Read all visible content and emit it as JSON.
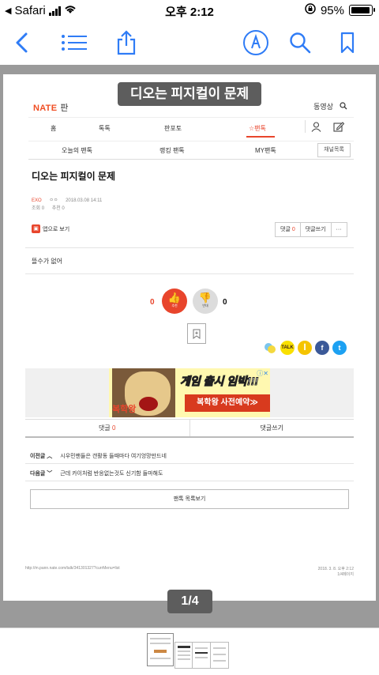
{
  "status_bar": {
    "carrier": "Safari",
    "time": "오후 2:12",
    "battery": "95%"
  },
  "toolbar": {
    "back_icon": "chevron-left-icon",
    "list_icon": "list-icon",
    "share_icon": "share-icon",
    "markup_icon": "markup-pen-icon",
    "search_icon": "search-icon",
    "bookmark_icon": "bookmark-icon"
  },
  "title_overlay": "디오는 피지컬이 문제",
  "page": {
    "logo": "NATE",
    "logo_sub": "판",
    "top_right_video": "동영상",
    "nav1": [
      "홈",
      "톡톡",
      "판포토",
      "☆팬톡"
    ],
    "nav2": [
      "오늘의 팬톡",
      "랭킹 팬톡",
      "MY팬톡"
    ],
    "channel_button": "채널목록",
    "post_title": "디오는 피지컬이 문제",
    "author": "EXO",
    "author_sub": "ㅇㅇ",
    "datetime": "2018.03.08 14:11",
    "views": "조회 0",
    "recommends": "추천 0",
    "app_view": "앱으로 보기",
    "comment_label": "댓글",
    "comment_count": "0",
    "write_comment": "댓글쓰기",
    "more": "···",
    "body": "뜰수가 없어",
    "like_count": "0",
    "like_label": "추천",
    "dislike_count": "0",
    "dislike_label": "반대",
    "ad": {
      "brand": "복학왕",
      "headline": "게임 출시 임박!!!",
      "cta": "복학왕 사전예약≫"
    },
    "tab_comment": "댓글",
    "tab_comment_count": "0",
    "tab_write": "댓글쓰기",
    "prev_label": "이전글",
    "prev_text": "시우민팬들은 갠활동 들때마다 여기엉망만드네",
    "next_label": "다음글",
    "next_text": "근데 카이처럼 반응없는것도 신기함 들마해도",
    "list_button": "팬톡 목록보기",
    "footer_url": "http://m.pann.nate.com/talk/341301327?currMenu=list",
    "footer_date": "2018. 3. 8. 오후 2:12",
    "footer_pages": "1/4페이지"
  },
  "page_indicator": "1/4",
  "colors": {
    "accent": "#2f7cf6",
    "nate_red": "#e8452c"
  }
}
